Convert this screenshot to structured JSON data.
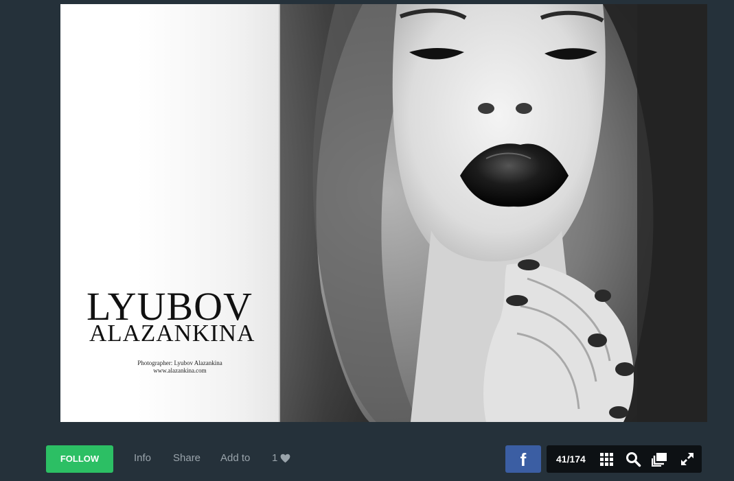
{
  "spread": {
    "left_page": {
      "name_line1": "LYUBOV",
      "name_line2": "ALAZANKINA",
      "credit_line1": "Photographer: Lyubov Alazankina",
      "credit_line2": "www.alazankina.com"
    },
    "right_page": {
      "image_icon": "black-and-white-portrait-photo"
    }
  },
  "bottom_bar": {
    "follow_label": "FOLLOW",
    "info_label": "Info",
    "share_label": "Share",
    "addto_label": "Add to",
    "likes_count": "1",
    "likes_icon": "heart-icon",
    "facebook_label": "f",
    "page_counter": "41/174",
    "tools": [
      "grid-icon",
      "search-icon",
      "pages-icon",
      "fullscreen-icon"
    ]
  },
  "colors": {
    "background": "#25313a",
    "follow_green": "#2cbf64",
    "facebook_blue": "#3b5ea3",
    "toolbar_dark": "#0d1114",
    "link_gray": "#9aa4ab"
  }
}
